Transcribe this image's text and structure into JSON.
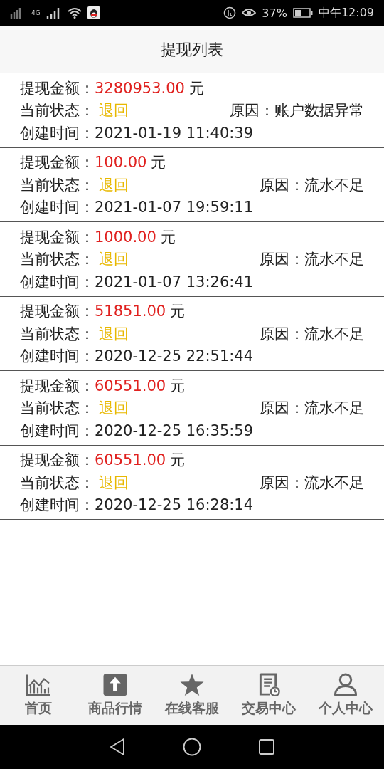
{
  "status_bar": {
    "network": "4G",
    "battery_percent": "37%",
    "time": "中午12:09"
  },
  "header": {
    "title": "提现列表"
  },
  "records": [
    {
      "amount_label": "提现金额：",
      "amount": "3280953.00",
      "unit": "元",
      "status_label": "当前状态：",
      "status": "退回",
      "reason_label": "原因：",
      "reason": "账户数据异常",
      "created_label": "创建时间：",
      "created": "2021-01-19 11:40:39"
    },
    {
      "amount_label": "提现金额：",
      "amount": "100.00",
      "unit": "元",
      "status_label": "当前状态：",
      "status": "退回",
      "reason_label": "原因：",
      "reason": "流水不足",
      "created_label": "创建时间：",
      "created": "2021-01-07 19:59:11"
    },
    {
      "amount_label": "提现金额：",
      "amount": "1000.00",
      "unit": "元",
      "status_label": "当前状态：",
      "status": "退回",
      "reason_label": "原因：",
      "reason": "流水不足",
      "created_label": "创建时间：",
      "created": "2021-01-07 13:26:41"
    },
    {
      "amount_label": "提现金额：",
      "amount": "51851.00",
      "unit": "元",
      "status_label": "当前状态：",
      "status": "退回",
      "reason_label": "原因：",
      "reason": "流水不足",
      "created_label": "创建时间：",
      "created": "2020-12-25 22:51:44"
    },
    {
      "amount_label": "提现金额：",
      "amount": "60551.00",
      "unit": "元",
      "status_label": "当前状态：",
      "status": "退回",
      "reason_label": "原因：",
      "reason": "流水不足",
      "created_label": "创建时间：",
      "created": "2020-12-25 16:35:59"
    },
    {
      "amount_label": "提现金额：",
      "amount": "60551.00",
      "unit": "元",
      "status_label": "当前状态：",
      "status": "退回",
      "reason_label": "原因：",
      "reason": "流水不足",
      "created_label": "创建时间：",
      "created": "2020-12-25 16:28:14"
    }
  ],
  "tab_bar": [
    {
      "kind": "chart",
      "label": "首页"
    },
    {
      "kind": "upload",
      "label": "商品行情"
    },
    {
      "kind": "star",
      "label": "在线客服"
    },
    {
      "kind": "document",
      "label": "交易中心"
    },
    {
      "kind": "person",
      "label": "个人中心"
    }
  ]
}
